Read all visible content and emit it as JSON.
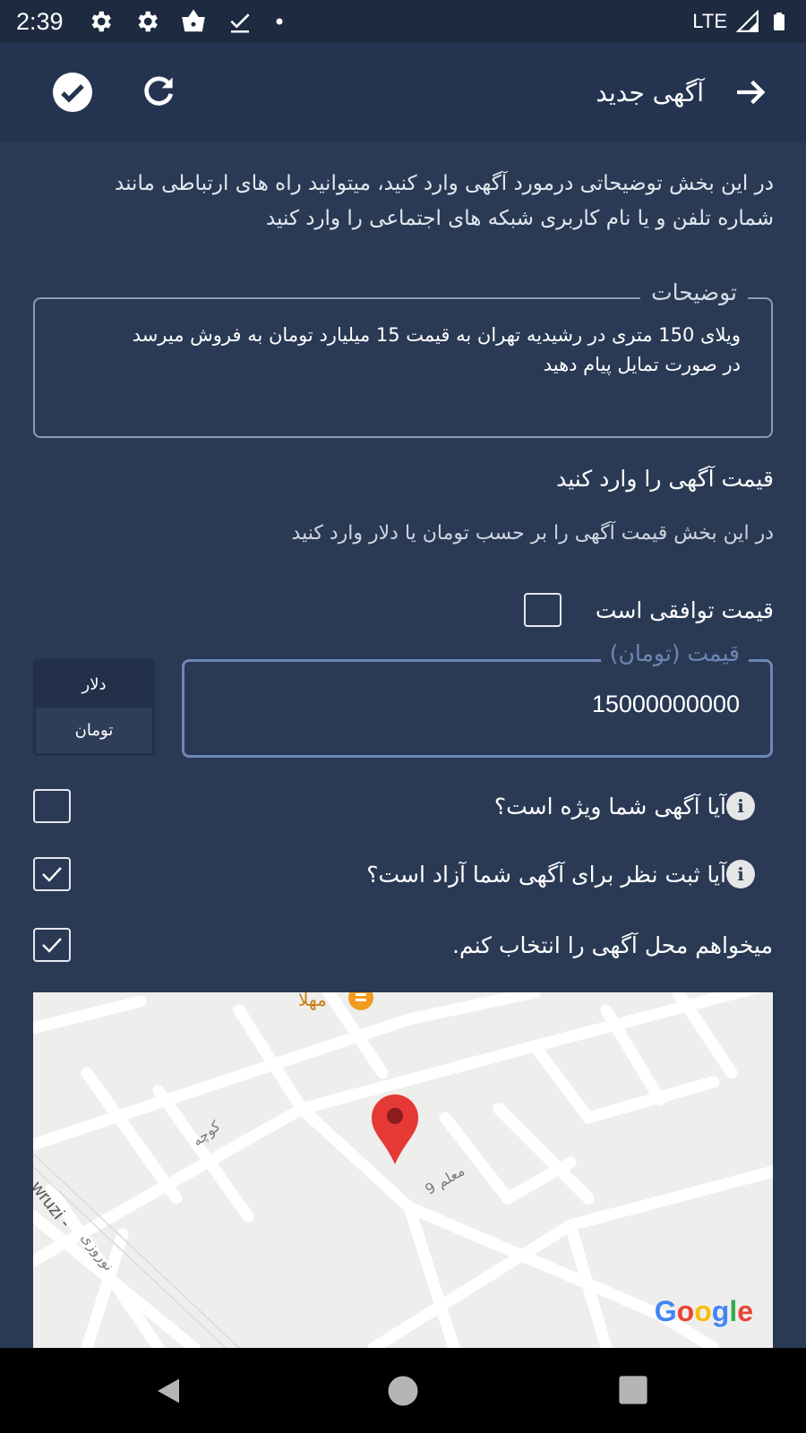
{
  "status_bar": {
    "time": "2:39",
    "network": "LTE",
    "icons": [
      "gear-icon",
      "gear-icon",
      "shopping-bag-icon",
      "download-done-icon",
      "notification-dot-icon",
      "signal-icon",
      "battery-icon"
    ]
  },
  "app_bar": {
    "title": "آگهی جدید",
    "icons": [
      "check-circle-icon",
      "refresh-icon",
      "arrow-right-icon"
    ]
  },
  "intro": {
    "text": "در این بخش توضیحاتی درمورد آگهی وارد کنید، میتوانید راه های ارتباطی مانند شماره تلفن و یا نام کاربری شبکه های اجتماعی را وارد کنید"
  },
  "description": {
    "label": "توضیحات",
    "lines": [
      "ویلای 150 متری در رشیدیه تهران به قیمت 15 میلیارد تومان به فروش میرسد",
      "در صورت تمایل پیام دهید"
    ]
  },
  "price_section": {
    "title": "قیمت آگهی را وارد کنید",
    "subtitle": "در این بخش قیمت آگهی را بر حسب تومان یا دلار وارد کنید",
    "negotiable_label": "قیمت توافقی است",
    "negotiable_checked": false,
    "field_label": "قیمت (تومان)",
    "field_value": "15000000000",
    "currency_options": [
      "دلار",
      "تومان"
    ],
    "currency_selected": "تومان"
  },
  "options": {
    "special_label": "آیا آگهی شما ویژه است؟",
    "special_checked": false,
    "comments_label": "آیا ثبت نظر برای آگهی شما آزاد است؟",
    "comments_checked": true,
    "location_label": "میخواهم محل آگهی را انتخاب کنم.",
    "location_checked": true
  },
  "map": {
    "labels": {
      "poi": "مهلا",
      "street_kuche": "کوچه",
      "street_moalem": "معلم 9",
      "street_nowruzi_en": "wruzi -",
      "street_nowruzi_fa": "نوروزی"
    },
    "logo": "Google",
    "pin_color": "#e53935"
  },
  "colors": {
    "background": "#2a3a55",
    "app_bar": "#243450",
    "status_bar": "#1d2a40",
    "accent": "#6d87b4"
  }
}
